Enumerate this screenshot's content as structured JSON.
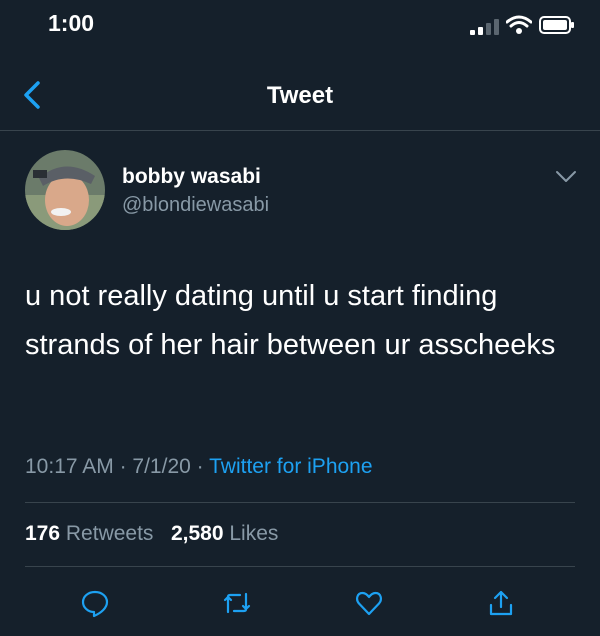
{
  "status_bar": {
    "time": "1:00",
    "icons": [
      "cellular-signal-icon",
      "wifi-icon",
      "battery-icon"
    ]
  },
  "nav": {
    "title": "Tweet",
    "back_icon": "chevron-left-icon"
  },
  "tweet": {
    "author_name": "bobby wasabi",
    "author_handle": "@blondiewasabi",
    "text": "u not really dating until u start finding strands of her hair between ur asscheeks",
    "time": "10:17 AM",
    "date": "7/1/20",
    "source": "Twitter for iPhone",
    "separator": "·"
  },
  "stats": {
    "retweets_count": "176",
    "retweets_label": "Retweets",
    "likes_count": "2,580",
    "likes_label": "Likes"
  },
  "actions": [
    "reply-icon",
    "retweet-icon",
    "like-icon",
    "share-icon"
  ],
  "colors": {
    "background": "#15202b",
    "accent": "#1da1f2",
    "secondary_text": "#8899a6",
    "divider": "#38444d"
  }
}
